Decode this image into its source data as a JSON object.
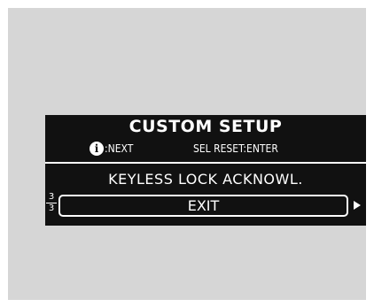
{
  "screen": {
    "title": "CUSTOM SETUP",
    "info_icon_glyph": "i",
    "next_hint": ":NEXT",
    "sel_hint": "SEL RESET:ENTER",
    "option_label": "KEYLESS LOCK ACKNOWL.",
    "page_current": "3",
    "page_total": "3",
    "exit_label": "EXIT",
    "arrow_icon": "right-triangle-icon"
  }
}
